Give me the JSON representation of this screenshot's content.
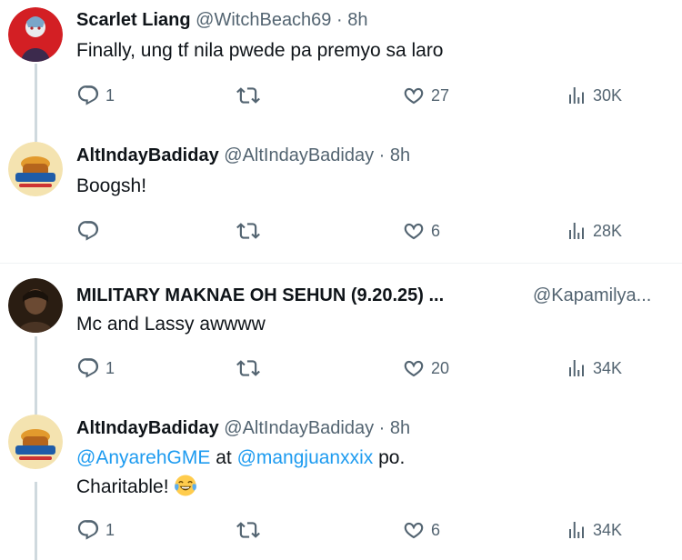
{
  "tweets": [
    {
      "name": "Scarlet Liang",
      "handle": "@WitchBeach69",
      "time": "· 8h",
      "text": "Finally, ung tf nila pwede pa premyo sa laro",
      "replies": "1",
      "reposts": "",
      "likes": "27",
      "views": "30K"
    },
    {
      "name": "AltIndayBadiday",
      "handle": "@AltIndayBadiday",
      "time": "· 8h",
      "text": "Boogsh!",
      "replies": "",
      "reposts": "",
      "likes": "6",
      "views": "28K"
    },
    {
      "name": "MILITARY MAKNAE OH SEHUN (9.20.25) ...",
      "handle": "@Kapamilya...",
      "time": "",
      "text": "Mc and Lassy awwww",
      "replies": "1",
      "reposts": "",
      "likes": "20",
      "views": "34K"
    },
    {
      "name": "AltIndayBadiday",
      "handle": "@AltIndayBadiday",
      "time": "· 8h",
      "mention1": "@AnyarehGME",
      "mid": " at ",
      "mention2": "@mangjuanxxix",
      "tail": " po.",
      "line2": "Charitable!",
      "replies": "1",
      "reposts": "",
      "likes": "6",
      "views": "34K"
    }
  ],
  "icons": {
    "reply": "reply-icon",
    "repost": "repost-icon",
    "like": "heart-icon",
    "views": "views-icon",
    "emoji": "face-with-tears-of-joy"
  },
  "colors": {
    "text": "#0f1419",
    "secondary": "#536471",
    "link": "#1d9bf0",
    "thread_line": "#cfd9de"
  }
}
